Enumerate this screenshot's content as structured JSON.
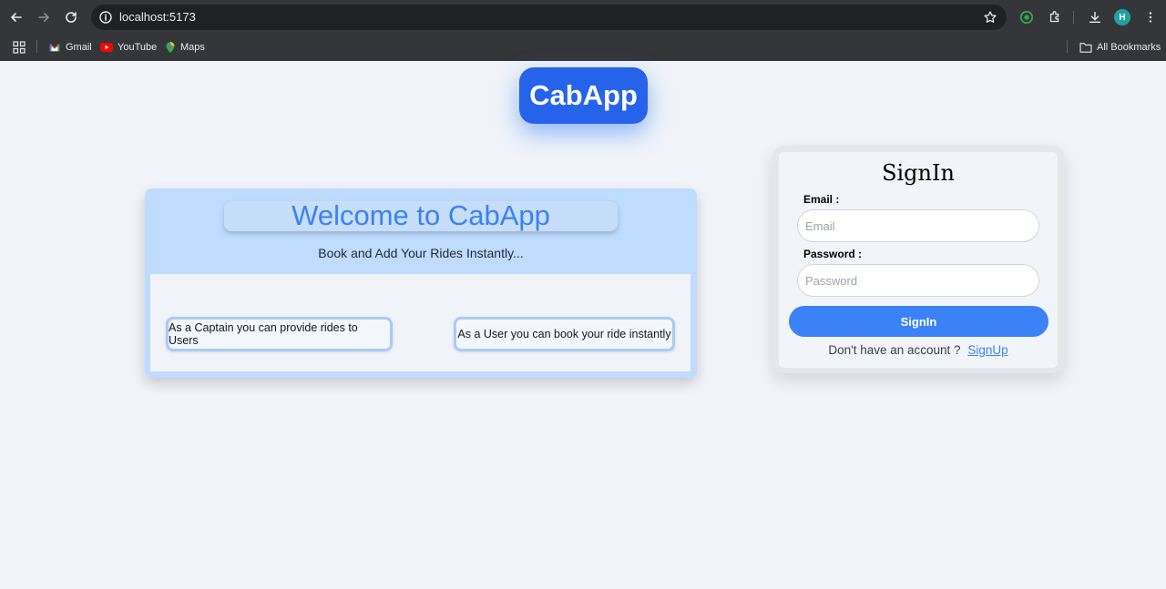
{
  "browser": {
    "url": "localhost:5173",
    "avatar_initial": "H",
    "bookmarks": [
      {
        "label": "Gmail"
      },
      {
        "label": "YouTube"
      },
      {
        "label": "Maps"
      }
    ],
    "all_bookmarks_label": "All Bookmarks"
  },
  "app": {
    "logo": "CabApp",
    "brand_color": "#2563eb"
  },
  "welcome": {
    "title": "Welcome to CabApp",
    "subtitle": "Book and Add Your Rides Instantly...",
    "captain_text": "As a Captain you can provide rides to Users",
    "user_text": "As a User you can book your ride instantly"
  },
  "signin": {
    "title": "SignIn",
    "email_label": "Email :",
    "email_placeholder": "Email",
    "password_label": "Password :",
    "password_placeholder": "Password",
    "button_label": "SignIn",
    "no_account_text": "Don't have an account ?",
    "signup_link": "SignUp"
  }
}
